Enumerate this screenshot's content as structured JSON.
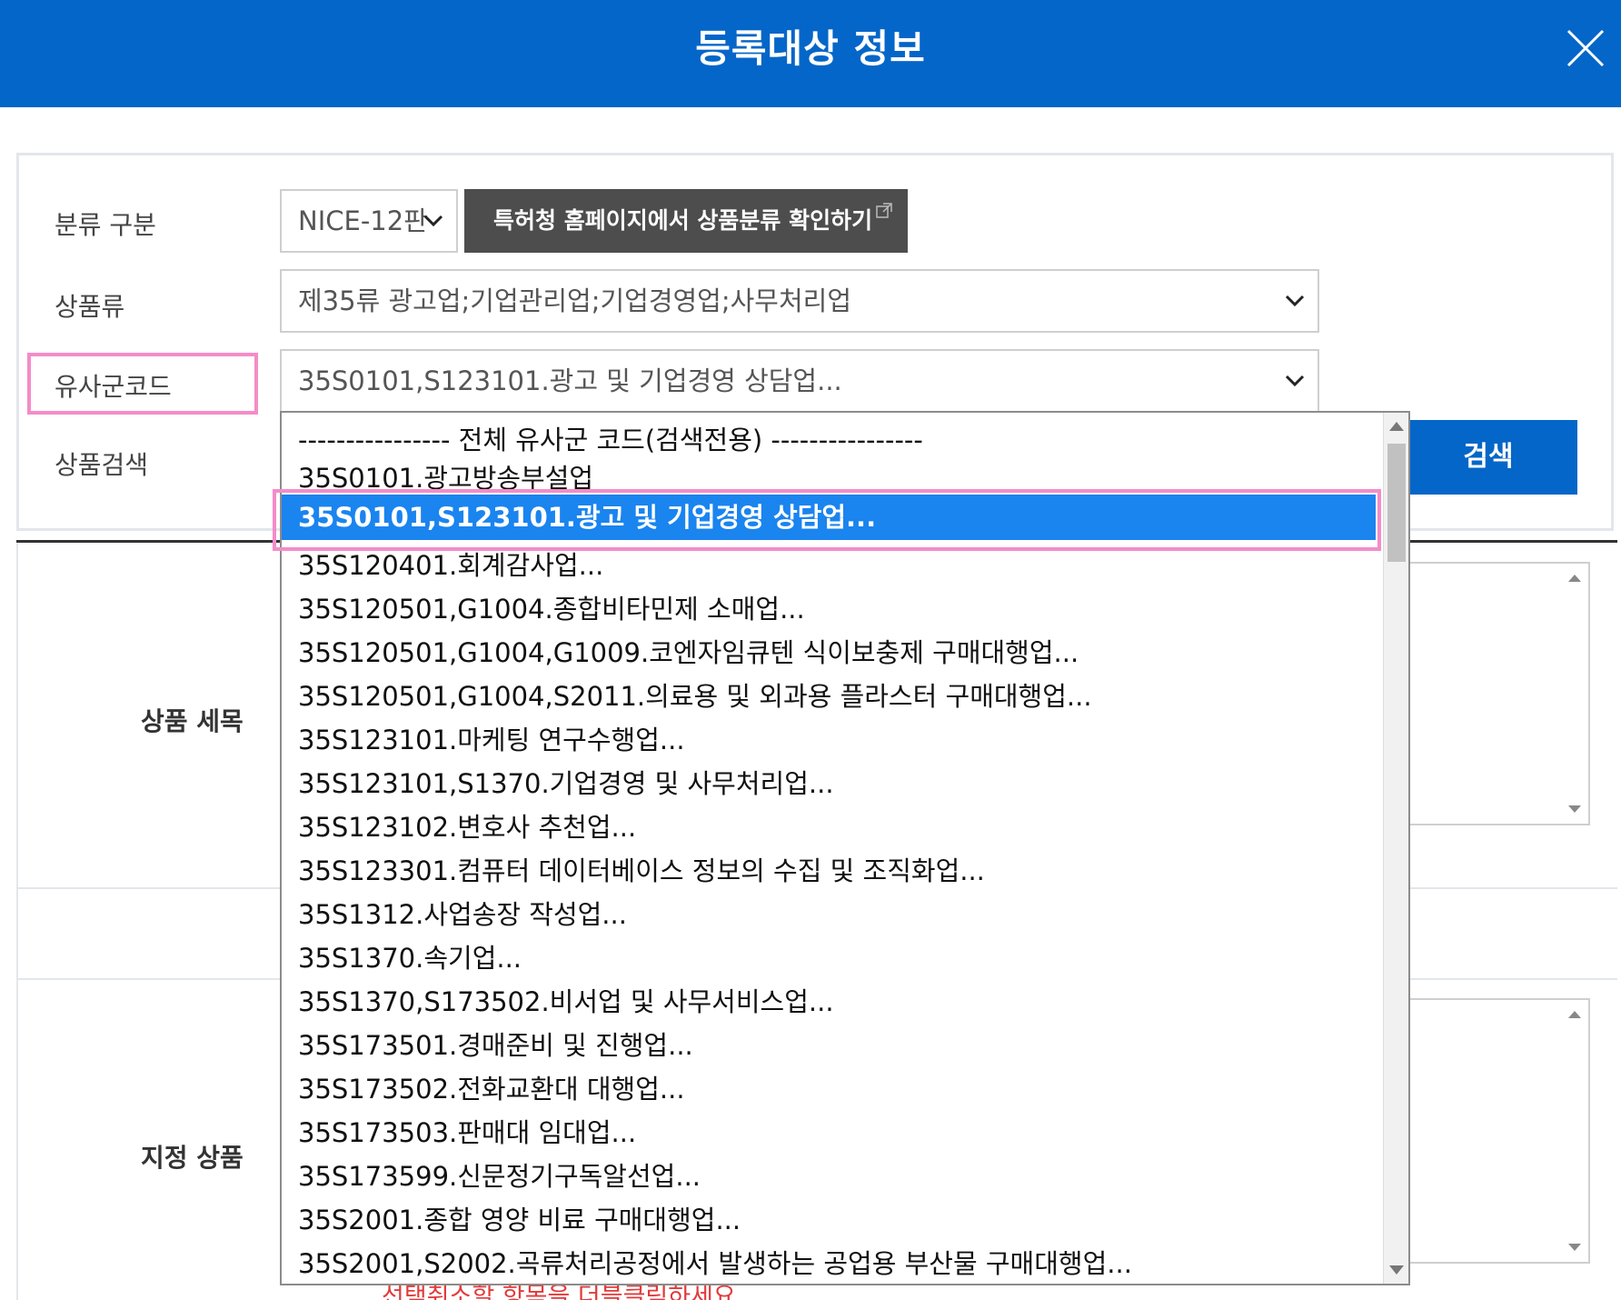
{
  "dialog": {
    "title": "등록대상 정보"
  },
  "form": {
    "class_type": {
      "label": "분류 구분",
      "value": "NICE-12판"
    },
    "kipo_link": {
      "label": "특허청 홈페이지에서 상품분류 확인하기"
    },
    "goods_class": {
      "label": "상품류",
      "value": "제35류 광고업;기업관리업;기업경영업;사무처리업"
    },
    "similar_code": {
      "label": "유사군코드",
      "value": "35S0101,S123101.광고 및 기업경영 상담업..."
    },
    "goods_search": {
      "label": "상품검색",
      "button": "검색"
    }
  },
  "sections": {
    "goods_detail": "상품 세목",
    "designated_goods": "지정 상품",
    "note": "선택취소할 항목을 더블클릭하세요."
  },
  "dropdown": {
    "options": [
      "---------------- 전체 유사군 코드(검색전용) ----------------",
      "35S0101.광고방송부설업",
      "35S0101,S123101.광고 및 기업경영 상담업...",
      "35S120401.회계감사업...",
      "35S120501,G1004.종합비타민제 소매업...",
      "35S120501,G1004,G1009.코엔자임큐텐 식이보충제 구매대행업...",
      "35S120501,G1004,S2011.의료용 및 외과용 플라스터 구매대행업...",
      "35S123101.마케팅 연구수행업...",
      "35S123101,S1370.기업경영 및 사무처리업...",
      "35S123102.변호사 추천업...",
      "35S123301.컴퓨터 데이터베이스 정보의 수집 및 조직화업...",
      "35S1312.사업송장 작성업...",
      "35S1370.속기업...",
      "35S1370,S173502.비서업 및 사무서비스업...",
      "35S173501.경매준비 및 진행업...",
      "35S173502.전화교환대 대행업...",
      "35S173503.판매대 임대업...",
      "35S173599.신문정기구독알선업...",
      "35S2001.종합 영양 비료 구매대행업...",
      "35S2001,S2002.곡류처리공정에서 발생하는 공업용 부산물 구매대행업..."
    ],
    "selected_index": 2
  }
}
